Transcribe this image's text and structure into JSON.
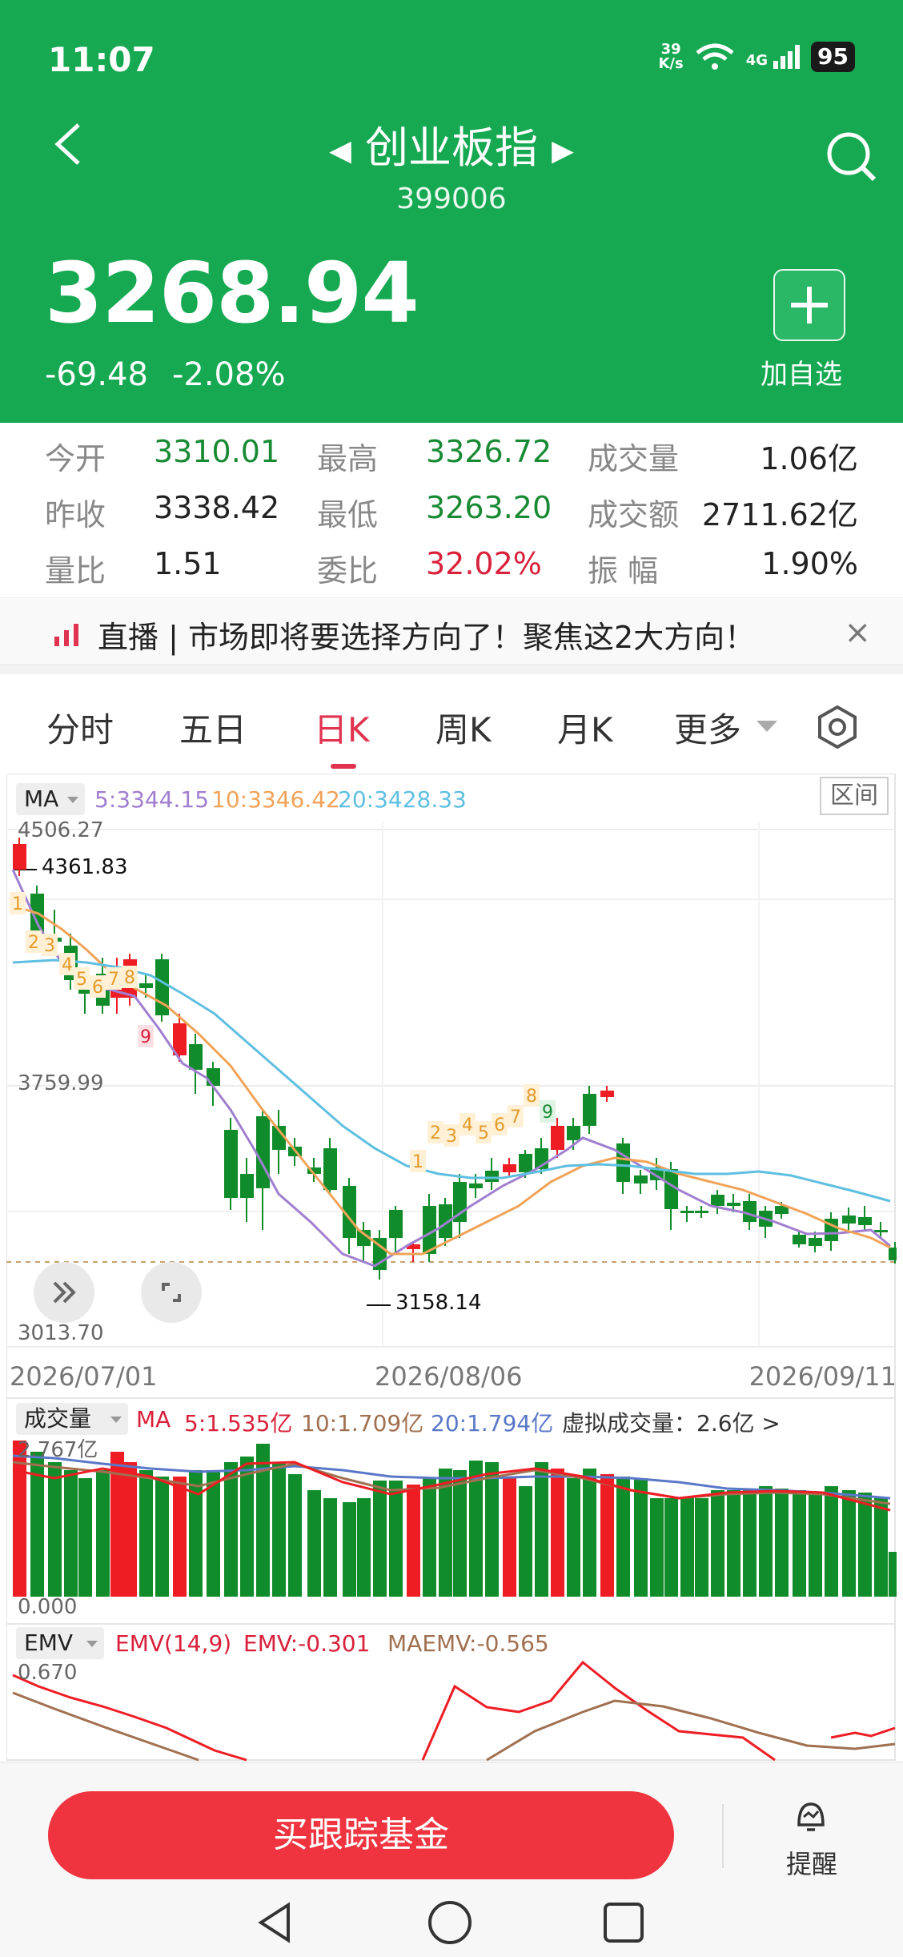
{
  "status": {
    "time": "11:07",
    "speed_num": "39",
    "speed_unit": "K/s",
    "net": "4G",
    "battery": "95"
  },
  "header": {
    "title": "创业板指",
    "code": "399006",
    "price": "3268.94",
    "change": "-69.48",
    "change_pct": "-2.08%",
    "add_label": "加自选"
  },
  "stats": [
    {
      "label": "今开",
      "value": "3310.01",
      "color": "green"
    },
    {
      "label": "最高",
      "value": "3326.72",
      "color": "green"
    },
    {
      "label": "成交量",
      "value": "1.06亿",
      "color": "black"
    },
    {
      "label": "昨收",
      "value": "3338.42",
      "color": "black"
    },
    {
      "label": "最低",
      "value": "3263.20",
      "color": "green"
    },
    {
      "label": "成交额",
      "value": "2711.62亿",
      "color": "black"
    },
    {
      "label": "量比",
      "value": "1.51",
      "color": "black"
    },
    {
      "label": "委比",
      "value": "32.02%",
      "color": "red"
    },
    {
      "label": "振 幅",
      "value": "1.90%",
      "color": "black"
    }
  ],
  "news": {
    "text": "直播 | 市场即将要选择方向了！聚焦这2大方向！",
    "close": "×"
  },
  "tabs": [
    "分时",
    "五日",
    "日K",
    "周K",
    "月K",
    "更多"
  ],
  "chart": {
    "ma_label": "MA",
    "ma5": "5:3344.15",
    "ma10": "10:3346.42",
    "ma20": "20:3428.33",
    "range_btn": "区间",
    "y_top": "4506.27",
    "y_mid": "3759.99",
    "y_bot": "3013.70",
    "high_mark": "4361.83",
    "low_mark": "3158.14",
    "dates": [
      "2026/07/01",
      "2026/08/06",
      "2026/09/11"
    ],
    "vol_label": "成交量",
    "vol_ma": "MA",
    "vol_ma5": "5:1.535亿",
    "vol_ma10": "10:1.709亿",
    "vol_ma20": "20:1.794亿",
    "vol_virtual": "虚拟成交量：2.6亿 >",
    "vol_top": "2.767亿",
    "vol_zero": "0.000",
    "emv_label": "EMV",
    "emv_name": "EMV(14,9)",
    "emv_val": "EMV:-0.301",
    "maemv_val": "MAEMV:-0.565",
    "emv_top": "0.670",
    "colors": {
      "up": "#ee1d24",
      "down": "#118c2a",
      "ma5": "#a07fd0",
      "ma10": "#f0a358",
      "ma20": "#5fbfe0"
    },
    "counts_a": [
      "1",
      "2",
      "3",
      "4",
      "5",
      "6",
      "7",
      "8",
      "9"
    ],
    "counts_b": [
      "1",
      "2",
      "3",
      "4",
      "5",
      "6",
      "7",
      "8",
      "9"
    ]
  },
  "bottom": {
    "buy_label": "买跟踪基金",
    "remind_label": "提醒"
  }
}
